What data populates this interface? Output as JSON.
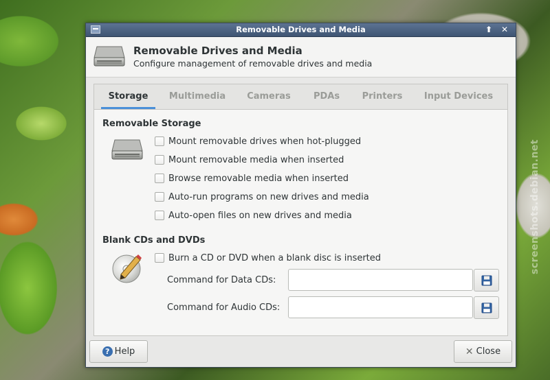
{
  "watermark": "screenshots.debian.net",
  "window": {
    "title": "Removable Drives and Media",
    "header_title": "Removable Drives and Media",
    "header_subtitle": "Configure management of removable drives and media"
  },
  "tabs": [
    {
      "label": "Storage",
      "active": true
    },
    {
      "label": "Multimedia",
      "active": false
    },
    {
      "label": "Cameras",
      "active": false
    },
    {
      "label": "PDAs",
      "active": false
    },
    {
      "label": "Printers",
      "active": false
    },
    {
      "label": "Input Devices",
      "active": false
    }
  ],
  "removable_storage": {
    "title": "Removable Storage",
    "options": [
      {
        "label": "Mount removable drives when hot-plugged",
        "checked": false
      },
      {
        "label": "Mount removable media when inserted",
        "checked": false
      },
      {
        "label": "Browse removable media when inserted",
        "checked": false
      },
      {
        "label": "Auto-run programs on new drives and media",
        "checked": false
      },
      {
        "label": "Auto-open files on new drives and media",
        "checked": false
      }
    ]
  },
  "blank_discs": {
    "title": "Blank CDs and DVDs",
    "burn_option": {
      "label": "Burn a CD or DVD when a blank disc is inserted",
      "checked": false
    },
    "data_cd": {
      "label": "Command for Data CDs:",
      "value": ""
    },
    "audio_cd": {
      "label": "Command for Audio CDs:",
      "value": ""
    }
  },
  "buttons": {
    "help": "Help",
    "close": "Close"
  },
  "colors": {
    "titlebar": "#4a6082",
    "tab_underline": "#4a90d9",
    "help_icon": "#3a6fb0"
  },
  "icons": {
    "header": "drive-harddisk-icon",
    "storage": "drive-harddisk-icon",
    "blank_disc": "media-optical-pencil-icon",
    "browse": "floppy-save-icon"
  }
}
